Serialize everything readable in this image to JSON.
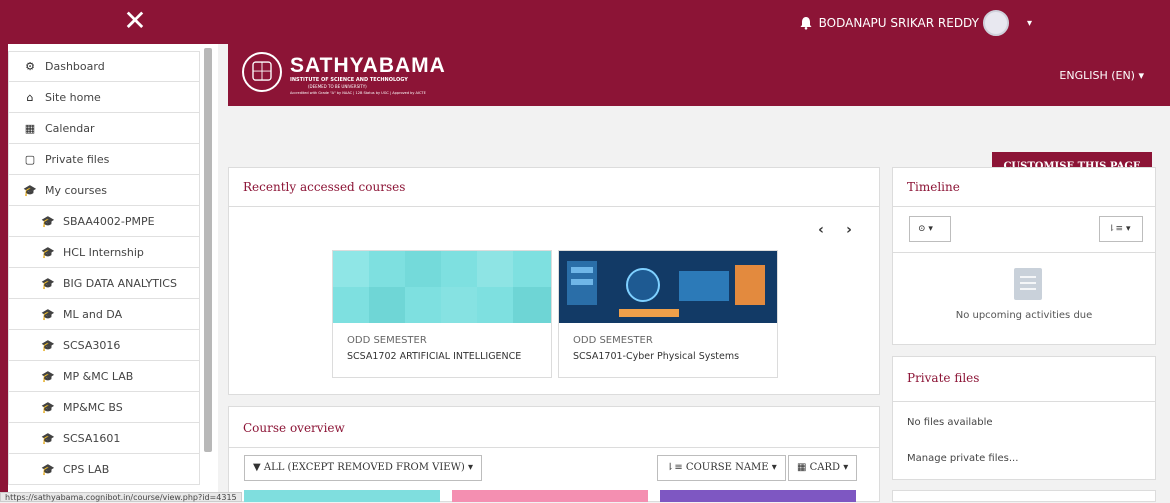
{
  "topbar": {
    "close_glyph": "✕",
    "user_name": "BODANAPU SRIKAR REDDY",
    "bell_icon": "bell-icon",
    "caret": "▾"
  },
  "sidebar": {
    "items": [
      {
        "label": "Dashboard",
        "icon": "tachometer-icon",
        "glyph": "⚙"
      },
      {
        "label": "Site home",
        "icon": "home-icon",
        "glyph": "⌂"
      },
      {
        "label": "Calendar",
        "icon": "calendar-icon",
        "glyph": "▦"
      },
      {
        "label": "Private files",
        "icon": "file-icon",
        "glyph": "▢"
      },
      {
        "label": "My courses",
        "icon": "graduation-cap-icon",
        "glyph": "🎓"
      },
      {
        "label": "SBAA4002-PMPE",
        "icon": "graduation-cap-icon",
        "glyph": "🎓"
      },
      {
        "label": "HCL Internship",
        "icon": "graduation-cap-icon",
        "glyph": "🎓"
      },
      {
        "label": "BIG DATA ANALYTICS",
        "icon": "graduation-cap-icon",
        "glyph": "🎓"
      },
      {
        "label": "ML and DA",
        "icon": "graduation-cap-icon",
        "glyph": "🎓"
      },
      {
        "label": "SCSA3016",
        "icon": "graduation-cap-icon",
        "glyph": "🎓"
      },
      {
        "label": "MP &MC LAB",
        "icon": "graduation-cap-icon",
        "glyph": "🎓"
      },
      {
        "label": "MP&MC BS",
        "icon": "graduation-cap-icon",
        "glyph": "🎓"
      },
      {
        "label": "SCSA1601",
        "icon": "graduation-cap-icon",
        "glyph": "🎓"
      },
      {
        "label": "CPS LAB",
        "icon": "graduation-cap-icon",
        "glyph": "🎓"
      }
    ]
  },
  "status_url": "https://sathyabama.cognibot.in/course/view.php?id=4315",
  "banner": {
    "name": "SATHYABAMA",
    "sub1": "INSTITUTE OF SCIENCE AND TECHNOLOGY",
    "sub2": "(DEEMED TO BE UNIVERSITY)",
    "sub3": "Accredited with Grade \"A\" by NAAC | 12B Status by UGC | Approved by AICTE",
    "language": "ENGLISH (EN) ▾"
  },
  "customise_label": "CUSTOMISE THIS PAGE",
  "recent": {
    "title": "Recently accessed courses",
    "prev": "‹",
    "next": "›",
    "courses": [
      {
        "category": "ODD SEMESTER",
        "name": "SCSA1702 ARTIFICIAL INTELLIGENCE"
      },
      {
        "category": "ODD SEMESTER",
        "name": "SCSA1701-Cyber Physical Systems"
      }
    ]
  },
  "overview": {
    "title": "Course overview",
    "filter": "▼ ALL (EXCEPT REMOVED FROM VIEW) ▾",
    "sort": "⇂≡ COURSE NAME ▾",
    "view": "▦ CARD ▾"
  },
  "timeline": {
    "title": "Timeline",
    "clock_dd": "⊙ ▾",
    "sort_dd": "⇂≡ ▾",
    "empty": "No upcoming activities due"
  },
  "private_files": {
    "title": "Private files",
    "none": "No files available",
    "manage": "Manage private files..."
  },
  "colors": {
    "brand": "#8c1436",
    "teal": "#7fdede",
    "pink": "#f48fb1",
    "purple": "#7e57c2"
  }
}
